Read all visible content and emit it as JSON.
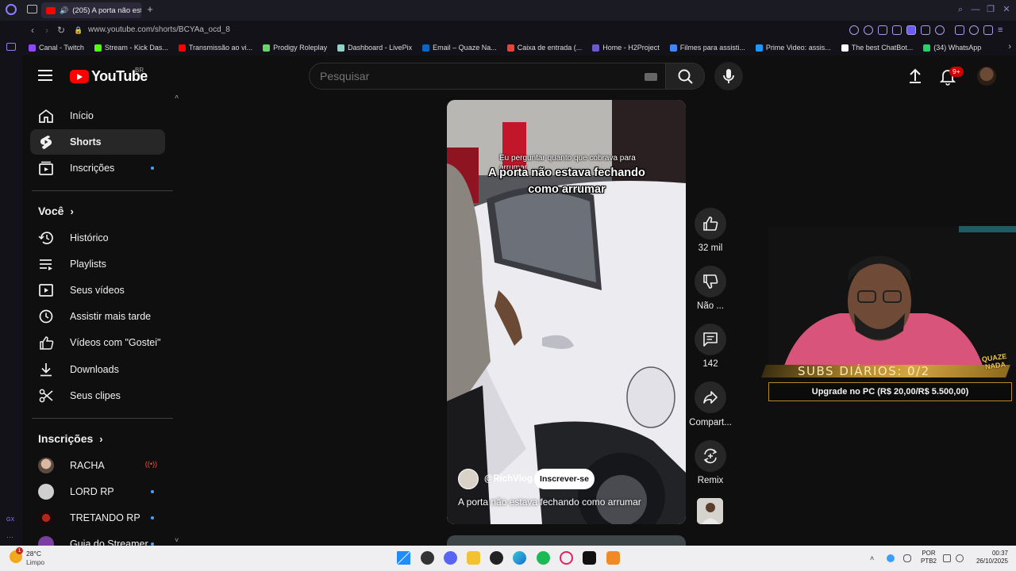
{
  "browser": {
    "active_tab_title": "(205) A porta não esta",
    "url": "www.youtube.com/shorts/BCYAa_ocd_8",
    "bookmarks": [
      {
        "label": "Canal - Twitch",
        "color": "#9146ff"
      },
      {
        "label": "Stream - Kick Das...",
        "color": "#53fc18"
      },
      {
        "label": "Transmissão ao vi...",
        "color": "#ff0000"
      },
      {
        "label": "Prodigy Roleplay",
        "color": "#6bd36b"
      },
      {
        "label": "Dashboard - LivePix",
        "color": "#8fd3c8"
      },
      {
        "label": "Email – Quaze Na...",
        "color": "#0a66c2"
      },
      {
        "label": "Caixa de entrada (...",
        "color": "#ea4335"
      },
      {
        "label": "Home - H2Project",
        "color": "#6a5acd"
      },
      {
        "label": "Filmes para assisti...",
        "color": "#4285f4"
      },
      {
        "label": "Prime Video: assis...",
        "color": "#1a98ff"
      },
      {
        "label": "The best ChatBot...",
        "color": "#ffffff"
      },
      {
        "label": "(34) WhatsApp",
        "color": "#25d366"
      }
    ]
  },
  "header": {
    "logo_text": "YouTube",
    "country_code": "BR",
    "search_placeholder": "Pesquisar",
    "notification_count": "9+"
  },
  "sidebar": {
    "main": [
      {
        "label": "Início",
        "icon": "home-icon"
      },
      {
        "label": "Shorts",
        "icon": "shorts-icon"
      },
      {
        "label": "Inscrições",
        "icon": "subscriptions-icon"
      }
    ],
    "you_heading": "Você",
    "you_items": [
      {
        "label": "Histórico",
        "icon": "history-icon"
      },
      {
        "label": "Playlists",
        "icon": "playlists-icon"
      },
      {
        "label": "Seus vídeos",
        "icon": "your-videos-icon"
      },
      {
        "label": "Assistir mais tarde",
        "icon": "watch-later-icon"
      },
      {
        "label": "Vídeos com \"Gostei\"",
        "icon": "liked-icon"
      },
      {
        "label": "Downloads",
        "icon": "download-icon"
      },
      {
        "label": "Seus clipes",
        "icon": "clips-icon"
      }
    ],
    "subs_heading": "Inscrições",
    "subscriptions": [
      {
        "name": "RACHA",
        "status": "live"
      },
      {
        "name": "LORD RP",
        "status": "new"
      },
      {
        "name": "TRETANDO RP",
        "status": "new"
      },
      {
        "name": "Guia do Streamer",
        "status": "new"
      }
    ]
  },
  "short": {
    "overlay_caption": "Eu perguntar quanto que cobrava para arrumar",
    "overlay_title": "A porta não estava fechando como arrumar",
    "channel_handle": "@RichVlog",
    "subscribe_label": "Inscrever-se",
    "title": "A porta não estava fechando como arrumar"
  },
  "actions": {
    "likes": "32 mil",
    "dislike": "Não ...",
    "comments": "142",
    "share": "Compart...",
    "remix": "Remix"
  },
  "stream_overlay": {
    "subs_text": "SUBS DIÁRIOS: 0/2",
    "logo_text": "QUAZE NADA",
    "upgrade_text": "Upgrade no PC (R$ 20,00/R$ 5.500,00)"
  },
  "taskbar": {
    "weather_alert": "1",
    "weather_temp": "28°C",
    "weather_condition": "Limpo",
    "lang_line1": "POR",
    "lang_line2": "PTB2",
    "time": "00:37",
    "date": "26/10/2025"
  }
}
